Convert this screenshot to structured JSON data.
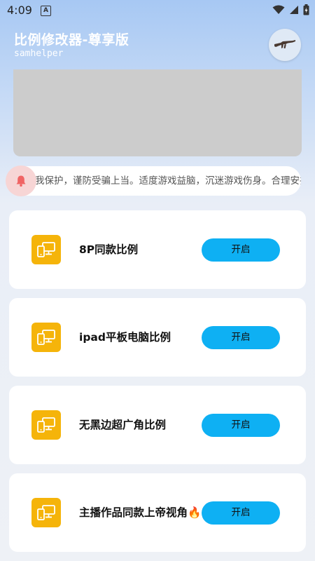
{
  "status_bar": {
    "time": "4:09",
    "notification_letter": "A"
  },
  "header": {
    "title": "比例修改器-尊享版",
    "subtitle": "samhelper"
  },
  "notice": {
    "text": "我保护，谨防受骗上当。适度游戏益脑，沉迷游戏伤身。合理安排"
  },
  "colors": {
    "accent_button": "#0eb0f3",
    "icon_tile": "#f5b40a",
    "bell_bg": "#f7d5d5",
    "bell_icon": "#f06464"
  },
  "icons": {
    "avatar": "rifle-icon",
    "bell": "bell-icon",
    "card": "phone-monitor-icon"
  },
  "cards": [
    {
      "title": "8P同款比例",
      "button": "开启"
    },
    {
      "title": "ipad平板电脑比例",
      "button": "开启"
    },
    {
      "title": "无黑边超广角比例",
      "button": "开启"
    },
    {
      "title": "主播作品同款上帝视角",
      "title_emoji": "🔥",
      "button": "开启"
    }
  ]
}
